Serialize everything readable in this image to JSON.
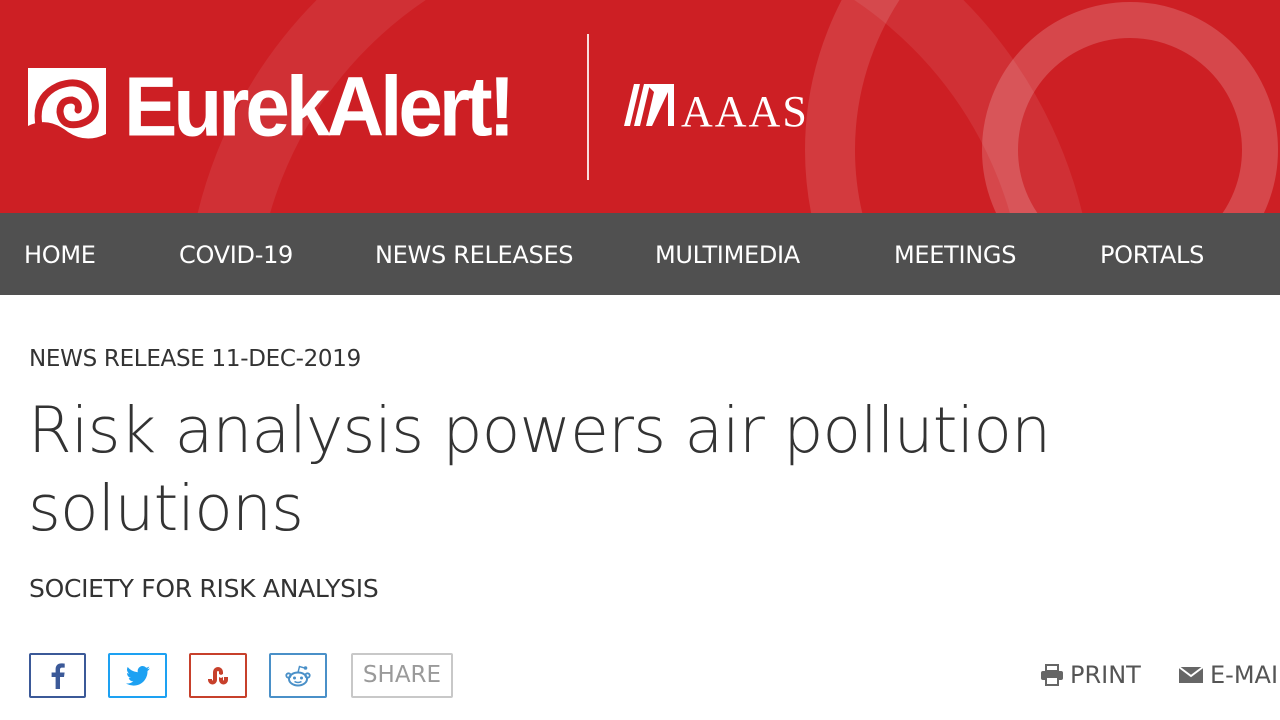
{
  "header": {
    "brand": "EurekAlert!",
    "partner": "AAAS",
    "brand_color": "#cd1f24"
  },
  "nav": {
    "items": [
      {
        "label": "HOME"
      },
      {
        "label": "COVID-19"
      },
      {
        "label": "NEWS RELEASES"
      },
      {
        "label": "MULTIMEDIA"
      },
      {
        "label": "MEETINGS"
      },
      {
        "label": "PORTALS"
      }
    ],
    "background": "#505050"
  },
  "article": {
    "kicker": "NEWS RELEASE 11-DEC-2019",
    "title": "Risk analysis powers air pollution solutions",
    "source": "SOCIETY FOR RISK ANALYSIS"
  },
  "share": {
    "buttons": [
      {
        "icon": "facebook-icon",
        "color": "#3b5998"
      },
      {
        "icon": "twitter-icon",
        "color": "#1da1f2"
      },
      {
        "icon": "stumbleupon-icon",
        "color": "#c7402b"
      },
      {
        "icon": "reddit-icon",
        "color": "#4a90c8"
      }
    ],
    "share_label": "SHARE",
    "print_label": "PRINT",
    "email_label": "E-MAIL"
  }
}
